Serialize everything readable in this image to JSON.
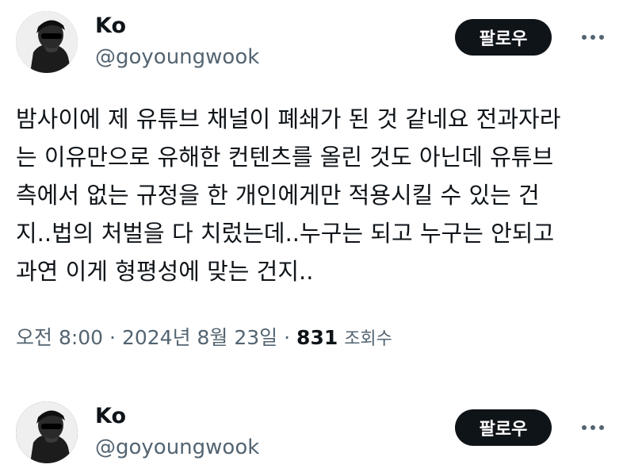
{
  "tweet1": {
    "display_name": "Ko",
    "handle": "@goyoungwook",
    "follow_label": "팔로우",
    "more_icon": "more-horizontal-icon",
    "body_lines": [
      "밤사이에 제 유튜브 채널이 폐쇄가 된 것 같네요 전과자라",
      "는 이유만으로 유해한 컨텐츠를 올린 것도 아닌데 유튜브",
      "측에서 없는 규정을 한 개인에게만 적용시킬 수 있는 건",
      "지..법의 처벌을 다 치렀는데..누구는 되고 누구는 안되고",
      "과연 이게 형평성에 맞는 건지.."
    ],
    "time": "오전 8:00",
    "separator": "·",
    "date": "2024년 8월 23일",
    "views_count": "831",
    "views_label": "조회수"
  },
  "tweet2": {
    "display_name": "Ko",
    "handle": "@goyoungwook",
    "follow_label": "팔로우",
    "more_icon": "more-horizontal-icon"
  },
  "colors": {
    "text_primary": "#0f1419",
    "text_secondary": "#536471",
    "button_bg": "#0f1419",
    "button_text": "#ffffff"
  }
}
